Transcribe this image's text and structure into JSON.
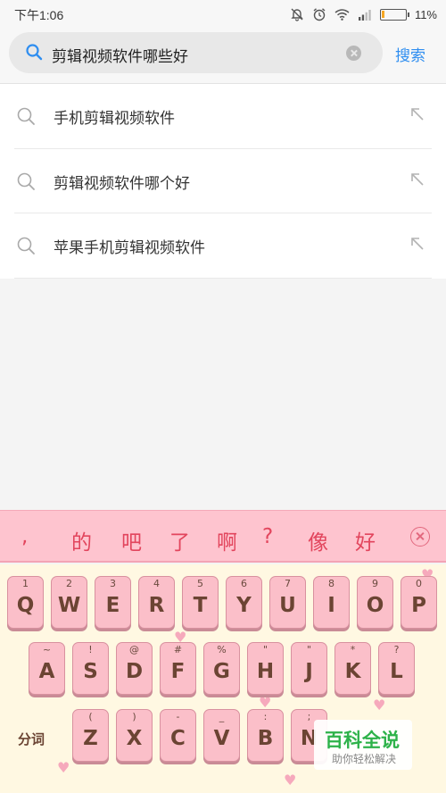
{
  "status_bar": {
    "time": "下午1:06",
    "battery_text": "11%",
    "battery_level": 0.11
  },
  "search": {
    "query": "剪辑视频软件哪些好",
    "submit_label": "搜索"
  },
  "suggestions": [
    {
      "text": "手机剪辑视频软件"
    },
    {
      "text": "剪辑视频软件哪个好"
    },
    {
      "text": "苹果手机剪辑视频软件"
    }
  ],
  "candidates": [
    ",",
    "的",
    "吧",
    "了",
    "啊",
    "?",
    "像",
    "好"
  ],
  "keyboard": {
    "row1": [
      {
        "main": "Q",
        "sub": "1"
      },
      {
        "main": "W",
        "sub": "2"
      },
      {
        "main": "E",
        "sub": "3"
      },
      {
        "main": "R",
        "sub": "4"
      },
      {
        "main": "T",
        "sub": "5"
      },
      {
        "main": "Y",
        "sub": "6"
      },
      {
        "main": "U",
        "sub": "7"
      },
      {
        "main": "I",
        "sub": "8"
      },
      {
        "main": "O",
        "sub": "9"
      },
      {
        "main": "P",
        "sub": "0"
      }
    ],
    "row2": [
      {
        "main": "A",
        "sub": "~"
      },
      {
        "main": "S",
        "sub": "!"
      },
      {
        "main": "D",
        "sub": "@"
      },
      {
        "main": "F",
        "sub": "#"
      },
      {
        "main": "G",
        "sub": "%"
      },
      {
        "main": "H",
        "sub": "\""
      },
      {
        "main": "J",
        "sub": "\""
      },
      {
        "main": "K",
        "sub": "*"
      },
      {
        "main": "L",
        "sub": "?"
      }
    ],
    "row3": [
      {
        "main": "Z",
        "sub": "("
      },
      {
        "main": "X",
        "sub": ")"
      },
      {
        "main": "C",
        "sub": "-"
      },
      {
        "main": "V",
        "sub": "_"
      },
      {
        "main": "B",
        "sub": ":"
      },
      {
        "main": "N",
        "sub": ";"
      }
    ],
    "split_label": "分词"
  },
  "watermark": {
    "title": "百科全说",
    "subtitle": "助你轻松解决"
  },
  "colors": {
    "accent": "#2f8ef0",
    "key": "#fbbfc9",
    "candidate": "#e2455d"
  }
}
